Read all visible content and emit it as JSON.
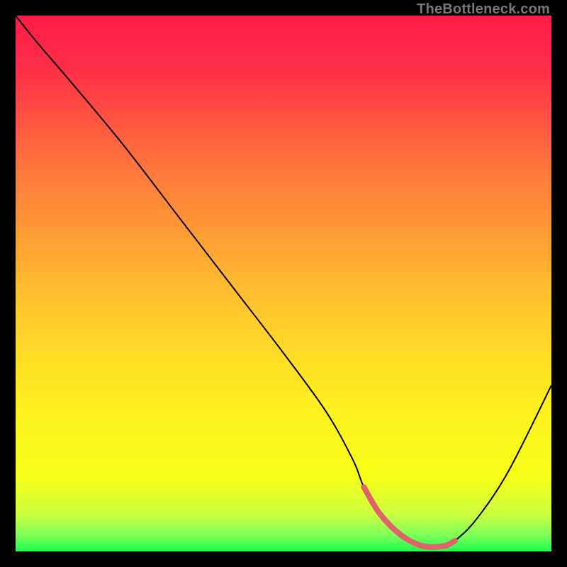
{
  "watermark": "TheBottleneck.com",
  "chart_data": {
    "type": "line",
    "title": "",
    "xlabel": "",
    "ylabel": "",
    "xlim": [
      0,
      100
    ],
    "ylim": [
      0,
      100
    ],
    "series": [
      {
        "name": "bottleneck-curve",
        "x": [
          0,
          4,
          10,
          20,
          30,
          40,
          50,
          58,
          63,
          65,
          68,
          72,
          76,
          80,
          82,
          86,
          92,
          100
        ],
        "y": [
          100,
          95,
          88,
          76,
          63,
          50,
          37,
          26,
          17,
          12,
          7,
          3,
          1,
          1,
          2,
          6,
          15,
          31
        ]
      }
    ],
    "highlight": {
      "name": "minimum-band",
      "x": [
        65,
        68,
        72,
        76,
        80,
        82
      ],
      "y": [
        12,
        7,
        3,
        1,
        1,
        2
      ]
    },
    "gradient_stops": [
      {
        "offset": 0.0,
        "color": "#ff1a49"
      },
      {
        "offset": 0.1,
        "color": "#ff2f47"
      },
      {
        "offset": 0.25,
        "color": "#ff6a3e"
      },
      {
        "offset": 0.4,
        "color": "#ff9a36"
      },
      {
        "offset": 0.55,
        "color": "#ffc82d"
      },
      {
        "offset": 0.72,
        "color": "#ffef20"
      },
      {
        "offset": 0.86,
        "color": "#f7ff18"
      },
      {
        "offset": 0.93,
        "color": "#cdff40"
      },
      {
        "offset": 0.97,
        "color": "#7dff5a"
      },
      {
        "offset": 1.0,
        "color": "#1aff4c"
      }
    ]
  }
}
